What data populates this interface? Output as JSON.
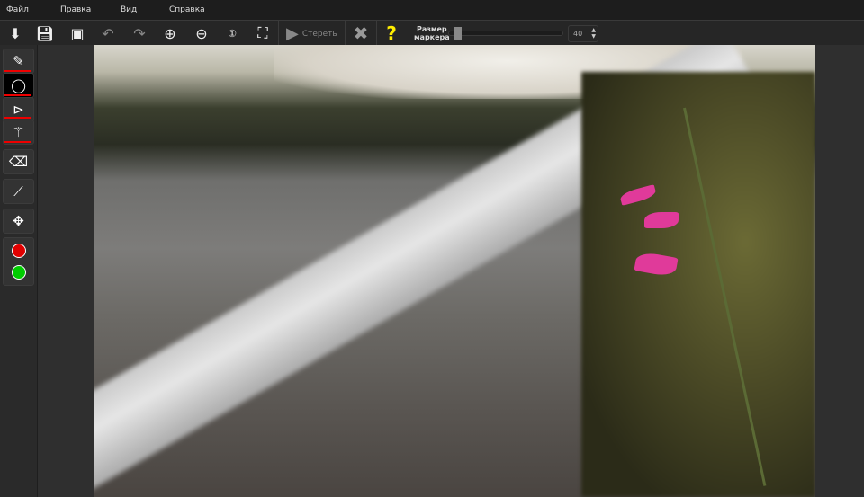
{
  "menu": [
    "Файл",
    "Правка",
    "Вид",
    "Справка"
  ],
  "toolbar": {
    "erase_label": "Стереть",
    "marker_size_label_1": "Размер",
    "marker_size_label_2": "маркера",
    "marker_size_value": "40",
    "help": "?"
  },
  "colors": {
    "red": "#e00000",
    "green": "#00cc00",
    "accent_underline": "#e00000",
    "help": "#ffee00"
  }
}
